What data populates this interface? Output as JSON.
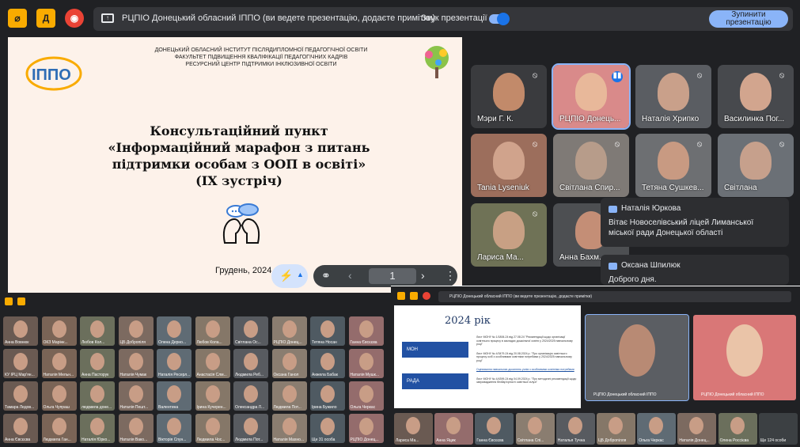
{
  "toolbar": {
    "presenting_text": "РЦПІО Донецький обласний ІППО (ви ведете презентацію, додаєте примітки)",
    "sound_label": "Звук презентації",
    "stop_label": "Зупинити презентацію"
  },
  "slide": {
    "institution_lines": [
      "ДОНЕЦЬКИЙ ОБЛАСНИЙ ІНСТИТУТ ПІСЛЯДИПЛОМНОЇ ПЕДАГОГІЧНОЇ ОСВІТИ",
      "ФАКУЛЬТЕТ ПІДВИЩЕННЯ КВАЛІФІКАЦІЇ ПЕДАГОГІЧНИХ КАДРІВ",
      "РЕСУРСНИЙ ЦЕНТР ПІДТРИМКИ ІНКЛЮЗИВНОЇ ОСВІТИ"
    ],
    "logo_text": "ІППО",
    "logo_caption": "ДОНЕЦЬКИЙ",
    "title_lines": [
      "Консультаційний пункт",
      "«Інформаційний марафон з питань",
      "підтримки особам з ООП в освіті»",
      "(IX зустріч)"
    ],
    "date": "Грудень, 2024",
    "page_number": "1"
  },
  "participants": [
    {
      "name": "Мэри Г. К.",
      "bg": "#3a3b3e",
      "skin": "#c28a6a"
    },
    {
      "name": "РЦПІО Донець...",
      "bg": "#d98a8a",
      "skin": "#e8b89a"
    },
    {
      "name": "Наталія Хрипко",
      "bg": "#5a5d62",
      "skin": "#c9a08a"
    },
    {
      "name": "Василинка Пог...",
      "bg": "#47494d",
      "skin": "#d2a58e"
    },
    {
      "name": "Tania Lyseniuk",
      "bg": "#9c6e5c",
      "skin": "#d0a38c"
    },
    {
      "name": "Світлана Спир...",
      "bg": "#7f7a76",
      "skin": "#b79c8a"
    },
    {
      "name": "Тетяна Сушкев...",
      "bg": "#6d6f72",
      "skin": "#c89a82"
    },
    {
      "name": "Світлана",
      "bg": "#6b7076",
      "skin": "#c6a08c"
    },
    {
      "name": "Лариса Ма...",
      "bg": "#6f7256",
      "skin": "#c8a084"
    },
    {
      "name": "Анна Бахм...",
      "bg": "#4d4f52",
      "skin": "#c48e76"
    }
  ],
  "chat_messages": [
    {
      "author": "Наталія Юркова",
      "text": "Вітає Новоселівський ліцей Лиманської міської ради Донецької області"
    },
    {
      "author": "Оксана Шпилюк",
      "text": "Доброго дня."
    }
  ],
  "mini_grid": {
    "names": [
      "Анна Вовнюк",
      "ОКЗ Марінк...",
      "Любов Кол...",
      "ЦБ Добропіля",
      "Олена Дерно...",
      "Любов Кола...",
      "Світлана Ос...",
      "РЦПІО Донец...",
      "Тетяна Носан",
      "Ганна Євсєєва",
      "КУ ІРЦ Мар'ян...",
      "Наталія Мельн...",
      "Анна Пасторук",
      "Наталія Чумак",
      "Наталія Ресерл...",
      "Анастасія Слм...",
      "Людмила Реб...",
      "Оксана Ганол",
      "Анжела Бабак",
      "Наталія Мушк...",
      "Тамара Ледов...",
      "Ольга Чупраш",
      "людмила доне...",
      "Наталія Пешт...",
      "Валентина",
      "Ірина Кучерен...",
      "Олександра Л...",
      "Людмила Пот...",
      "Ірина Бужило",
      "Ольга Черкас",
      "Анна Євсєєва",
      "Людмила Ган...",
      "Наталія Юрко...",
      "Наталія Вако...",
      "Вікторія Спун...",
      "Людмила Чос...",
      "Людмила Пот...",
      "Наталія Махно...",
      "Ще 31 особа",
      "РЦПІО Донец..."
    ]
  },
  "mini_window": {
    "bar_text": "РЦПІО Донецький обласний ІППО (ви ведете презентацію, додаєте примітки)",
    "slide_year": "2024 рік",
    "box1": "МОН",
    "box2": "РАДА",
    "list_items": [
      "Лист МОНУ № 1/1806-24 від 27.08.24 \"Рекомендації щодо організації освітнього процесу в закладах дошкільної освіти у 2024/2025 навчальному році\"",
      "Лист МОНУ № 4/3479-24 від 20.08.2024 р. \"Про організацію освітнього процесу осіб з особливими освітніми потребами у 2024/2025 навчальному році\"",
      "Оцінювання навчальних досягнень учнів з особливими освітніми потребами",
      "Лист МОНУ № 4/4399-24 від 04.09.2024 р. \"Про методичні рекомендації щодо запровадження безбар'єрності освітньої галузі\""
    ],
    "video1_name": "РЦПІО Донецький обласний ІППО",
    "video2_name": "РЦПІО Донецький обласний ІППО",
    "strip_names": [
      "Лариса Ма...",
      "Анна Яцик",
      "Ганна Євсєєва",
      "Світлана Спі...",
      "Наталья Тучна",
      "ЦБ Добропілля",
      "Ольга Черкас",
      "Наталія Донец...",
      "Олена Россієва",
      "Ще 124 особи"
    ]
  },
  "colors": {
    "accent": "#8ab4f8",
    "record_red": "#ea4335",
    "toolbar_yellow": "#f9ab00",
    "slide_bg": "#fdf2ea"
  }
}
